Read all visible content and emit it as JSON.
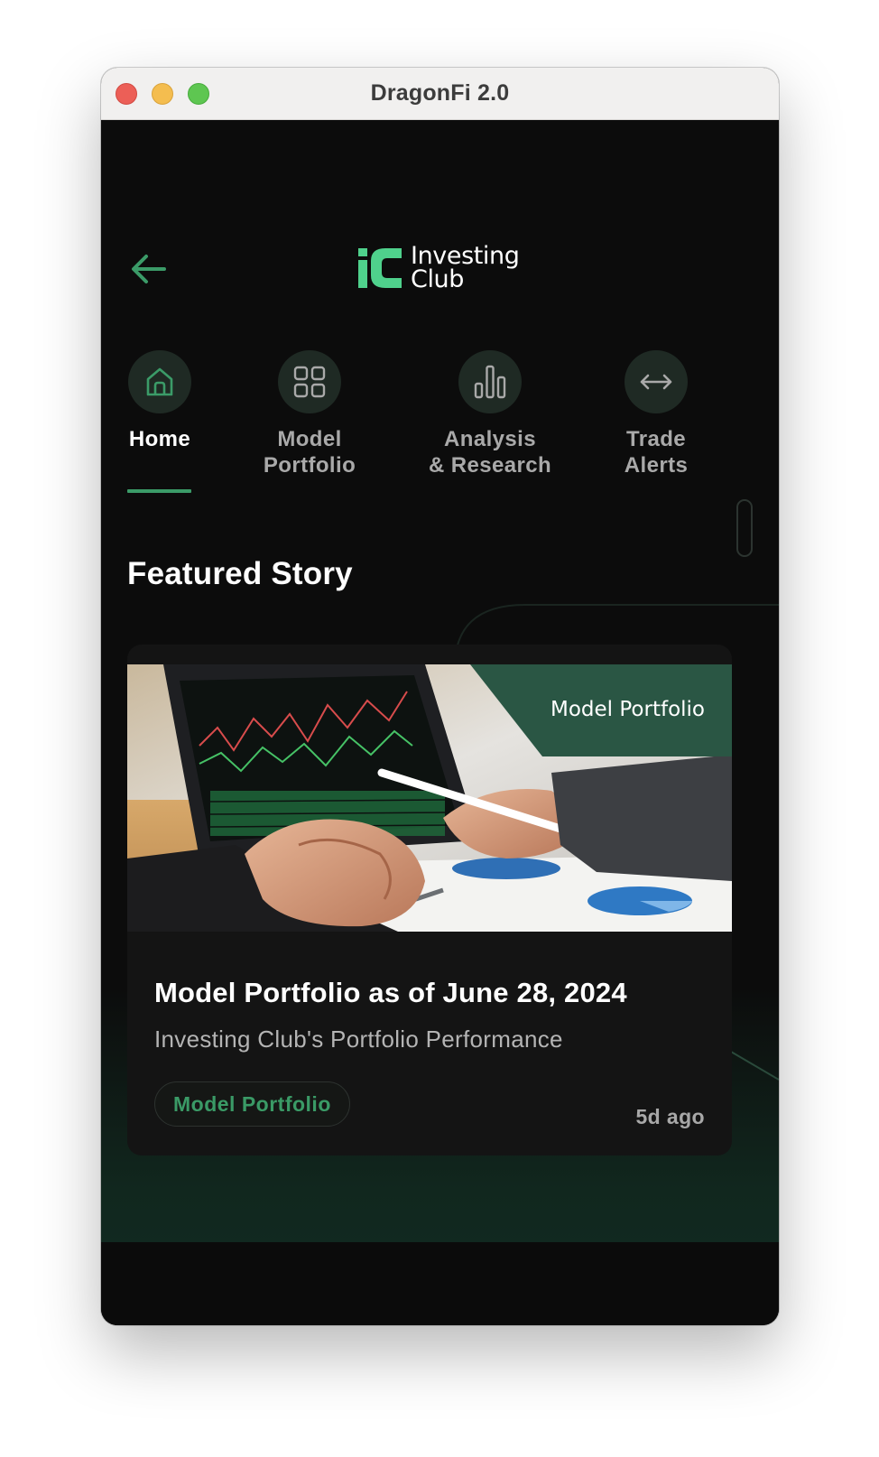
{
  "window": {
    "title": "DragonFi 2.0"
  },
  "header": {
    "back_icon": "arrow-left-icon",
    "logo": {
      "mark": "IC",
      "line1": "Investing",
      "line2": "Club"
    }
  },
  "nav": {
    "items": [
      {
        "label": "Home",
        "icon": "home-icon",
        "active": true
      },
      {
        "label": "Model\nPortfolio",
        "icon": "grid-icon",
        "active": false
      },
      {
        "label": "Analysis\n& Research",
        "icon": "bar-chart-icon",
        "active": false
      },
      {
        "label": "Trade\nAlerts",
        "icon": "arrows-horizontal-icon",
        "active": false
      }
    ]
  },
  "featured": {
    "section_title": "Featured Story",
    "card": {
      "ribbon": "Model Portfolio",
      "title": "Model Portfolio as of June 28, 2024",
      "subtitle": "Investing Club's Portfolio Performance",
      "tag": "Model Portfolio",
      "time": "5d ago"
    }
  },
  "colors": {
    "accent": "#3b9b68",
    "logo_green": "#4fd18c",
    "ribbon": "#2a5644",
    "background": "#0c0c0c",
    "card": "#141414"
  }
}
